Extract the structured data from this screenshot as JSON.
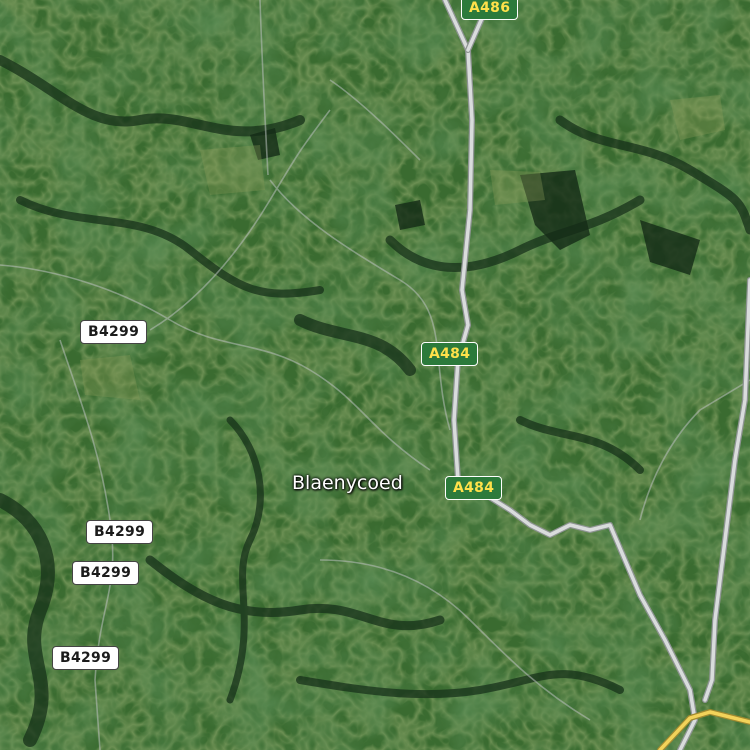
{
  "map": {
    "type": "satellite",
    "place_labels": [
      {
        "id": "blaenycoed",
        "text": "Blaenycoed"
      }
    ],
    "road_labels": [
      {
        "id": "a486",
        "text": "A486",
        "class": "A-road"
      },
      {
        "id": "a484-north",
        "text": "A484",
        "class": "A-road"
      },
      {
        "id": "a484-south",
        "text": "A484",
        "class": "A-road"
      },
      {
        "id": "b4299-1",
        "text": "B4299",
        "class": "B-road"
      },
      {
        "id": "b4299-2",
        "text": "B4299",
        "class": "B-road"
      },
      {
        "id": "b4299-3",
        "text": "B4299",
        "class": "B-road"
      },
      {
        "id": "b4299-4",
        "text": "B4299",
        "class": "B-road"
      }
    ],
    "colors": {
      "a_road_fill": "#2c7a3b",
      "a_road_text": "#ffe14a",
      "b_road_fill": "#ffffff",
      "major_road_line": "#cfd3d6",
      "primary_road_line": "#f2d35a"
    }
  }
}
